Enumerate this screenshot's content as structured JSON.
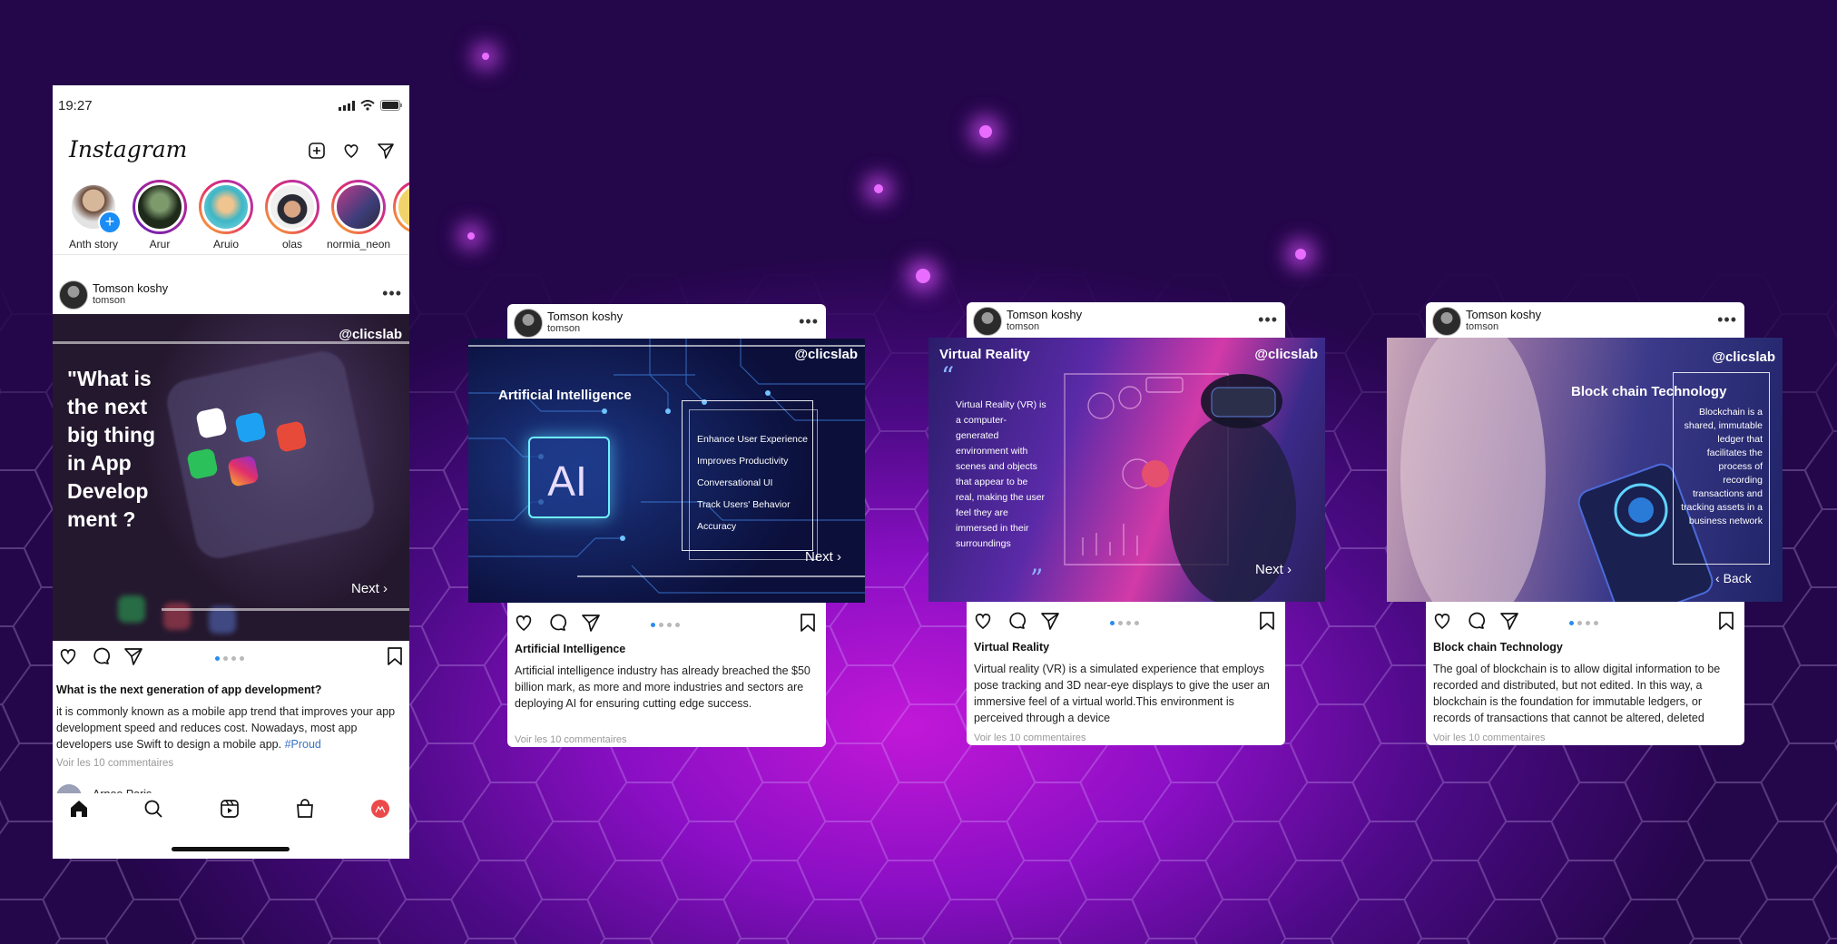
{
  "phone": {
    "status_time": "19:27",
    "app_name": "Instagram",
    "header_icons": [
      "add-post-icon",
      "heart-icon",
      "send-icon"
    ],
    "stories": [
      {
        "name": "Anth story"
      },
      {
        "name": "Arur"
      },
      {
        "name": "Aruio"
      },
      {
        "name": "olas"
      },
      {
        "name": "normia_neon"
      }
    ],
    "post": {
      "author": "Tomson koshy",
      "username": "tomson",
      "handle": "@clicslab",
      "headline": "\"What is the next big thing in App Develop ment ?",
      "next_label": "Next",
      "caption_title": "What is the next generation  of app development?",
      "caption_text": "it is commonly known as a mobile app trend that improves your app development speed and reduces cost. Nowadays, most app developers use Swift to design a mobile app.",
      "hashtag": "#Proud",
      "comments": "Voir les 10 commentaires",
      "next_commenter": "Arnoe Paris",
      "app_labels": [
        "Google Photos",
        "Twitter",
        "Storyist",
        "WhatsApp",
        "Instagram"
      ]
    },
    "nav_icons": [
      "home-icon",
      "search-icon",
      "reels-icon",
      "shop-icon",
      "profile-icon"
    ]
  },
  "cards": [
    {
      "author": "Tomson koshy",
      "username": "tomson",
      "handle": "@clicslab",
      "image_title": "Artificial Intelligence",
      "chip_label": "AI",
      "list": [
        "Enhance User Experience",
        "Improves Productivity",
        "Conversational UI",
        "Track Users' Behavior",
        "Accuracy"
      ],
      "nav_label": "Next",
      "caption_title": "Artificial Intelligence",
      "caption_text": "Artificial intelligence industry has already breached the $50 billion mark, as more and more industries and sectors are deploying AI for ensuring cutting edge success.",
      "comments": "Voir les 10 commentaires"
    },
    {
      "author": "Tomson koshy",
      "username": "tomson",
      "handle": "@clicslab",
      "image_title": "Virtual Reality",
      "image_text": "Virtual Reality (VR) is a computer-generated environment with scenes and objects that appear to be real, making the user feel they are immersed in their surroundings",
      "nav_label": "Next",
      "caption_title": "Virtual Reality",
      "caption_text": "Virtual reality (VR) is a simulated experience that employs pose tracking and 3D near-eye displays to give the user an immersive feel of a virtual world.This environment is perceived through a device",
      "comments": "Voir les 10 commentaires"
    },
    {
      "author": "Tomson koshy",
      "username": "tomson",
      "handle": "@clicslab",
      "image_title": "Block chain  Technology",
      "image_text": "Blockchain is a shared, immutable ledger that facilitates the process of recording transactions and tracking assets in a business network",
      "nav_label": "Back",
      "caption_title": "Block chain Technology",
      "caption_text": "The goal of blockchain is to allow digital information to be recorded and distributed, but not edited. In this way, a blockchain is the foundation for immutable ledgers, or records of transactions that cannot be altered, deleted",
      "comments": "Voir les 10 commentaires"
    }
  ],
  "carousel": {
    "total": 4,
    "active": 1
  },
  "colors": {
    "accent_blue": "#2a8cf0",
    "story_ring": "#e12f6a",
    "bg_purple": "#8a0fc4"
  }
}
